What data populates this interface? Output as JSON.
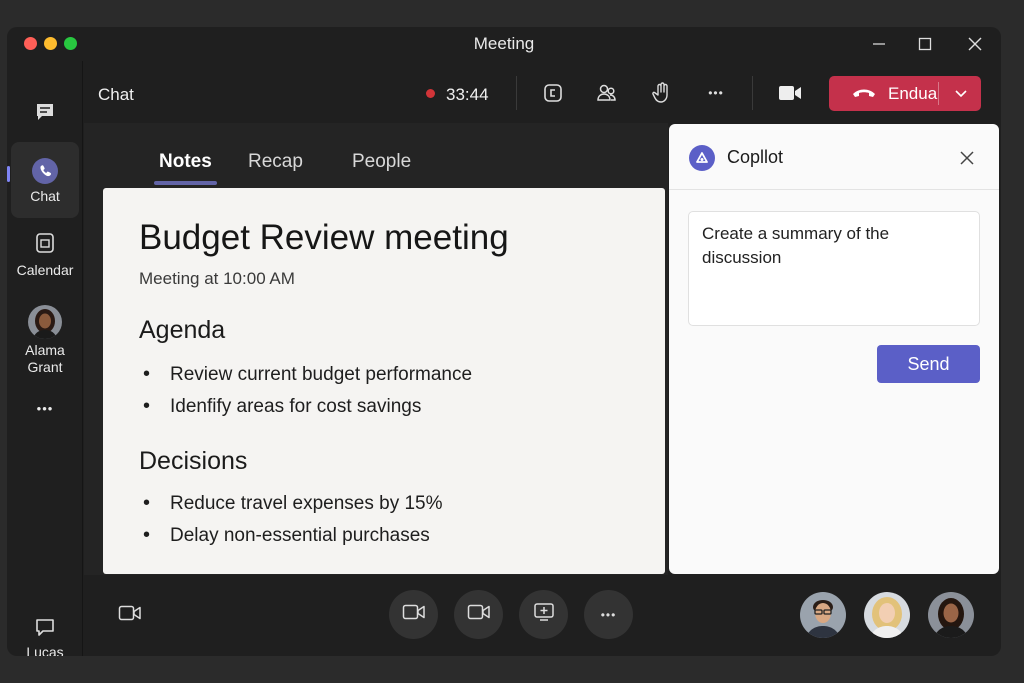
{
  "window": {
    "title": "Meeting"
  },
  "rail": {
    "items": [
      {
        "label": "Chat",
        "icon": "chat-bubble-icon",
        "active": true
      },
      {
        "label": "Calendar",
        "icon": "calendar-icon",
        "active": false
      },
      {
        "label_line1": "Alama",
        "label_line2": "Grant",
        "icon": "avatar"
      },
      {
        "label": "Lucas",
        "icon": "chat-outline-icon"
      }
    ],
    "more": "•••"
  },
  "topbar": {
    "chat_label": "Chat",
    "timer": "33:44",
    "end_label": "Endua"
  },
  "tabs": [
    {
      "label": "Notes",
      "active": true
    },
    {
      "label": "Recap",
      "active": false
    },
    {
      "label": "People",
      "active": false
    }
  ],
  "notes": {
    "title": "Budget Review meeting",
    "subtitle": "Meeting at 10:00 AM",
    "agenda_heading": "Agenda",
    "agenda": [
      "Review current budget performance",
      "Idenfify areas for cost savings"
    ],
    "decisions_heading": "Decisions",
    "decisions": [
      "Reduce travel expenses by 15%",
      "Delay non-essential purchases"
    ]
  },
  "copilot": {
    "title": "Copllot",
    "prompt": "Create a summary of the discussion",
    "send_label": "Send"
  },
  "bottom": {
    "more": "•••"
  },
  "colors": {
    "accent": "#6264a7",
    "end_call": "#c4314b",
    "recording": "#d13438"
  }
}
